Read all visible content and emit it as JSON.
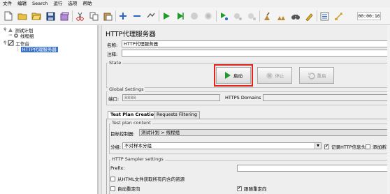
{
  "menu": [
    "文件",
    "编辑",
    "Search",
    "运行",
    "选项",
    "帮助"
  ],
  "toolbar": {
    "timer": "00:00:16"
  },
  "tree": {
    "items": [
      {
        "label": "测试计划"
      },
      {
        "label": "线程组"
      },
      {
        "label": "工作台"
      },
      {
        "label": "HTTP代理服务器"
      }
    ]
  },
  "panel": {
    "title": "HTTP代理服务器",
    "name_label": "名称:",
    "name_value": "HTTP代理服务器",
    "comment_label": "注释:",
    "comment_value": ""
  },
  "state": {
    "title": "State",
    "start": "启动",
    "stop": "停止",
    "restart": "重启"
  },
  "global": {
    "title": "Global Settings",
    "port_label": "端口:",
    "port_value": "8888",
    "https_label": "HTTPS Domains :",
    "https_value": ""
  },
  "tabs": [
    "Test Plan Creation",
    "Requests Filtering"
  ],
  "plan": {
    "title": "Test plan content",
    "target_label": "目标控制器:",
    "target_value": "测试计划 > 线程组",
    "group_label": "分组:",
    "group_value": "不对样本分组",
    "record_headers": "记录HTTP信息头",
    "add_assert": "添加断言"
  },
  "sampler": {
    "title": "HTTP Sampler settings",
    "prefix_label": "Prefix:",
    "prefix_value": "",
    "retrieve": "从HTML文件获取所有内含的资源",
    "auto_redirect": "自动重定向",
    "follow_redirect": "跟随重定向"
  },
  "colors": {
    "accent_selection": "#3a73c9",
    "highlight": "#e2231a",
    "start_green": "#1f9a2a"
  }
}
